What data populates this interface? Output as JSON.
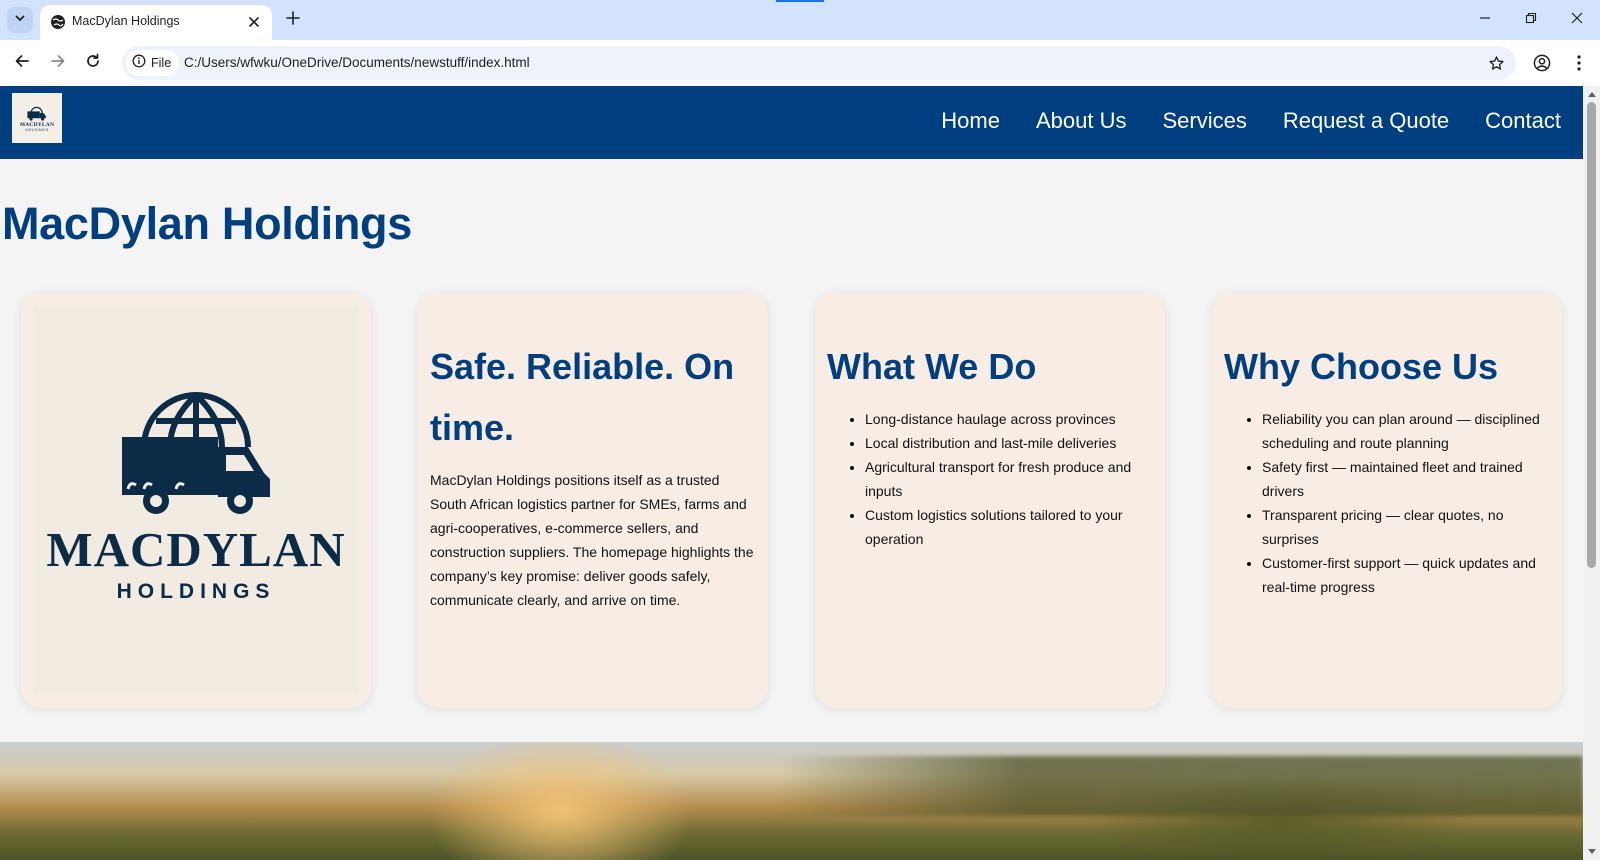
{
  "browser": {
    "tab_title": "MacDylan Holdings",
    "chip_label": "File",
    "url": "C:/Users/wfwku/OneDrive/Documents/newstuff/index.html"
  },
  "site": {
    "logo": {
      "name": "MACDYLAN",
      "sub": "HOLDINGS"
    },
    "nav": [
      "Home",
      "About Us",
      "Services",
      "Request a Quote",
      "Contact"
    ],
    "page_title": "MacDylan Holdings",
    "cards": {
      "promise": {
        "heading": "Safe. Reliable. On time.",
        "body": "MacDylan Holdings positions itself as a trusted South African logistics partner for SMEs, farms and agri-cooperatives, e-commerce sellers, and construction suppliers. The homepage highlights the company’s key promise: deliver goods safely, communicate clearly, and arrive on time."
      },
      "what_we_do": {
        "heading": "What We Do",
        "items": [
          "Long-distance haulage across provinces",
          "Local distribution and last-mile deliveries",
          "Agricultural transport for fresh produce and inputs",
          "Custom logistics solutions tailored to your operation"
        ]
      },
      "why_choose_us": {
        "heading": "Why Choose Us",
        "items": [
          "Reliability you can plan around — disciplined scheduling and route planning",
          "Safety first — maintained fleet and trained drivers",
          "Transparent pricing — clear quotes, no surprises",
          "Customer-first support — quick updates and real-time progress"
        ]
      }
    }
  },
  "colors": {
    "brand_navy": "#003f7f",
    "card_bg": "#f7ede4",
    "page_bg": "#f4f4f4",
    "tabbar_bg": "#d3e3fd"
  },
  "icons": {
    "tab_list": "chevron-down-icon",
    "favicon": "globe-icon",
    "tab_close": "close-icon",
    "new_tab": "plus-icon",
    "back": "arrow-left-icon",
    "forward": "arrow-right-icon",
    "reload": "reload-icon",
    "site_info": "info-icon",
    "bookmark": "star-icon",
    "profile": "account-icon",
    "menu": "more-vert-icon"
  }
}
